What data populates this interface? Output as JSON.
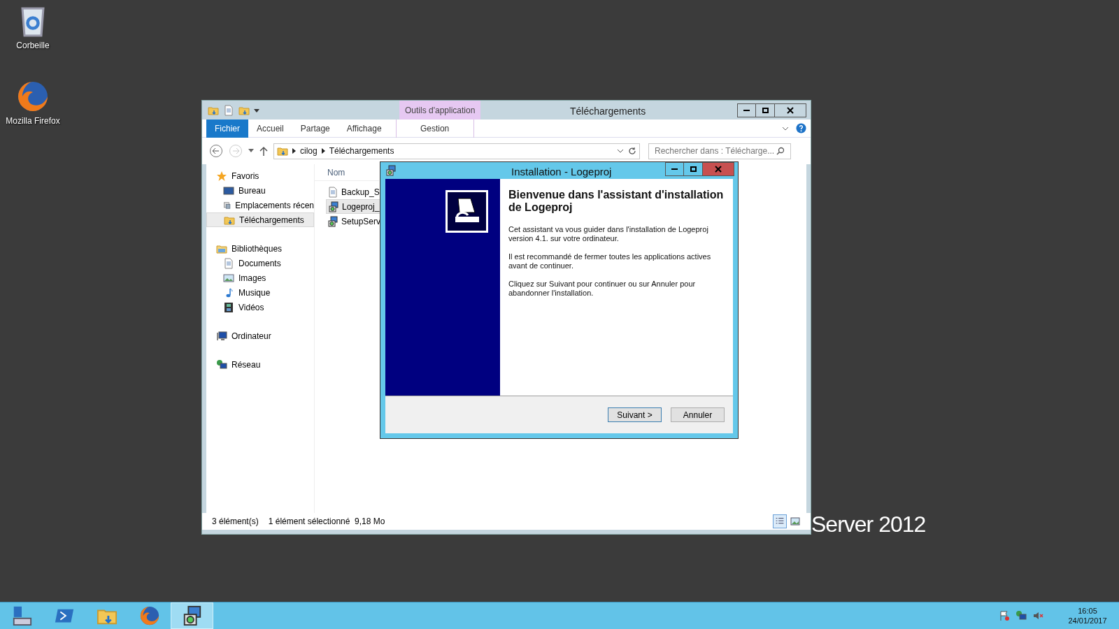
{
  "desktop": {
    "icons": [
      {
        "kind": "recycle",
        "label": "Corbeille"
      },
      {
        "kind": "firefox",
        "label": "Mozilla Firefox"
      }
    ],
    "brand": "Server 2012"
  },
  "explorer": {
    "title": "Téléchargements",
    "context_group": "Outils d'application",
    "tabs": [
      {
        "label": "Fichier",
        "kind": "file",
        "selected": true
      },
      {
        "label": "Accueil",
        "kind": "tab",
        "selected": false
      },
      {
        "label": "Partage",
        "kind": "tab",
        "selected": false
      },
      {
        "label": "Affichage",
        "kind": "tab",
        "selected": false
      },
      {
        "label": "Gestion",
        "kind": "context",
        "selected": false
      }
    ],
    "path": [
      "cilog",
      "Téléchargements"
    ],
    "search": {
      "placeholder": "Rechercher dans : Télécharge..."
    },
    "nav": [
      {
        "kind": "star",
        "label": "Favoris",
        "selected": false,
        "children": [
          {
            "kind": "desktop",
            "label": "Bureau",
            "selected": false
          },
          {
            "kind": "recent",
            "label": "Emplacements récen",
            "selected": false
          },
          {
            "kind": "folder",
            "label": "Téléchargements",
            "selected": true
          }
        ]
      },
      {
        "kind": "library",
        "label": "Bibliothèques",
        "selected": false,
        "children": [
          {
            "kind": "document",
            "label": "Documents",
            "selected": false
          },
          {
            "kind": "image",
            "label": "Images",
            "selected": false
          },
          {
            "kind": "music",
            "label": "Musique",
            "selected": false
          },
          {
            "kind": "video",
            "label": "Vidéos",
            "selected": false
          }
        ]
      },
      {
        "kind": "computer",
        "label": "Ordinateur",
        "selected": false
      },
      {
        "kind": "network",
        "label": "Réseau",
        "selected": false
      }
    ],
    "column": "Nom",
    "files": [
      {
        "kind": "file",
        "name": "Backup_S",
        "selected": false
      },
      {
        "kind": "setup",
        "name": "Logeproj_",
        "selected": true
      },
      {
        "kind": "setup",
        "name": "SetupServ",
        "selected": false
      }
    ],
    "status": [
      "3 élément(s)",
      "1 élément sélectionné  9,18 Mo"
    ]
  },
  "dialog": {
    "title": "Installation - Logeproj",
    "heading": "Bienvenue dans l'assistant d'installation de Logeproj",
    "paragraphs": [
      "Cet assistant va vous guider dans l'installation de Logeproj version 4.1. sur votre ordinateur.",
      "Il est recommandé de fermer toutes les applications actives avant de continuer.",
      "Cliquez sur Suivant pour continuer ou sur Annuler pour abandonner l'installation."
    ],
    "buttons": [
      {
        "label": "Suivant >",
        "default": true
      },
      {
        "label": "Annuler",
        "default": false
      }
    ]
  },
  "taskbar": {
    "apps": [
      {
        "kind": "server",
        "selected": false
      },
      {
        "kind": "powershell",
        "selected": false
      },
      {
        "kind": "explorer",
        "selected": false
      },
      {
        "kind": "firefox",
        "selected": false
      },
      {
        "kind": "setup",
        "selected": true
      }
    ],
    "tray": [
      {
        "kind": "flag"
      },
      {
        "kind": "network"
      },
      {
        "kind": "volume"
      }
    ],
    "time": "16:05",
    "date": "24/01/2017"
  }
}
